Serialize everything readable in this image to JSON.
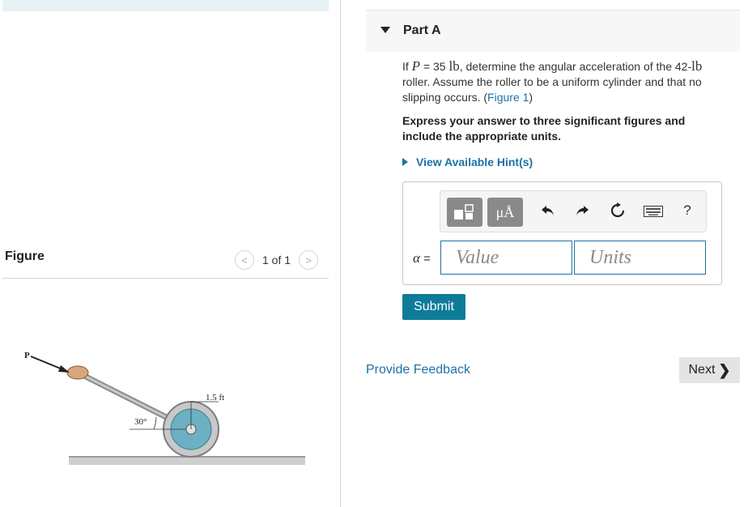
{
  "figure_panel": {
    "title": "Figure",
    "pager_text": "1 of 1",
    "prev_icon": "chevron-left-icon",
    "next_icon": "chevron-right-icon",
    "diagram_labels": {
      "force": "P",
      "angle": "30°",
      "radius": "1.5 ft"
    }
  },
  "part": {
    "title": "Part A",
    "question_pre": "If ",
    "question_var": "P",
    "question_eq": " = 35 ",
    "question_unit": "lb",
    "question_mid": ", determine the angular acceleration of the 42-",
    "question_unit2": "lb",
    "question_post": " roller. Assume the roller to be a uniform cylinder and that no slipping occurs. (",
    "figure_link": "Figure 1",
    "question_close": ")",
    "instructions": "Express your answer to three significant figures and include the appropriate units.",
    "hint_label": "View Available Hint(s)"
  },
  "answer": {
    "variable": "α",
    "equals": " =",
    "value_placeholder": "Value",
    "units_placeholder": "Units",
    "toolbar": {
      "templates_icon": "templates-icon",
      "units_label": "μÅ",
      "undo_icon": "undo-icon",
      "redo_icon": "redo-icon",
      "reset_icon": "reset-icon",
      "keyboard_icon": "keyboard-icon",
      "help_label": "?"
    },
    "submit_label": "Submit"
  },
  "footer": {
    "feedback_label": "Provide Feedback",
    "next_label": "Next",
    "next_chevron": "❯"
  },
  "colors": {
    "link": "#1d72a8",
    "submit": "#0e7c99",
    "top_bar": "#e6f3f5"
  }
}
